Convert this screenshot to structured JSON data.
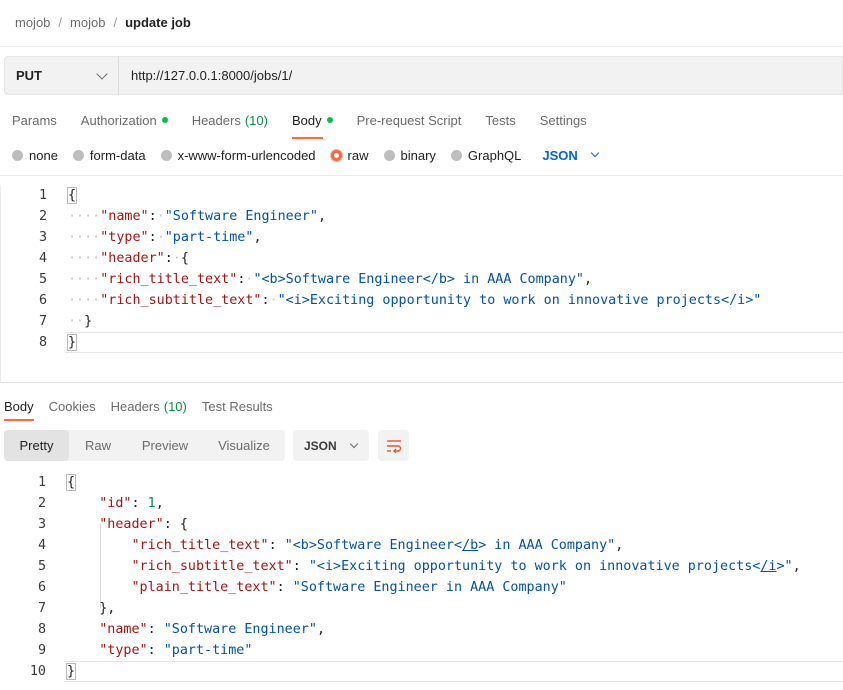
{
  "breadcrumb": {
    "items": [
      "mojob",
      "mojob"
    ],
    "current": "update job",
    "separator": "/"
  },
  "request": {
    "method": "PUT",
    "url": "http://127.0.0.1:8000/jobs/1/"
  },
  "request_tabs": {
    "params": "Params",
    "authorization": "Authorization",
    "headers": "Headers",
    "headers_count": "(10)",
    "body": "Body",
    "prerequest": "Pre-request Script",
    "tests": "Tests",
    "settings": "Settings"
  },
  "body_types": {
    "none": "none",
    "form_data": "form-data",
    "urlencoded": "x-www-form-urlencoded",
    "raw": "raw",
    "binary": "binary",
    "graphql": "GraphQL",
    "format": "JSON",
    "selected": "raw"
  },
  "request_body": {
    "line_numbers": [
      "1",
      "2",
      "3",
      "4",
      "5",
      "6",
      "7",
      "8"
    ],
    "name_key": "\"name\"",
    "name_val": "\"Software Engineer\"",
    "type_key": "\"type\"",
    "type_val": "\"part-time\"",
    "header_key": "\"header\"",
    "rich_title_key": "\"rich_title_text\"",
    "rich_title_val": "\"<b>Software Engineer</b> in AAA Company\"",
    "rich_subtitle_key": "\"rich_subtitle_text\"",
    "rich_subtitle_val": "\"<i>Exciting opportunity to work on innovative projects</i>\""
  },
  "response_tabs": {
    "body": "Body",
    "cookies": "Cookies",
    "headers": "Headers",
    "headers_count": "(10)",
    "test_results": "Test Results"
  },
  "response_view": {
    "pretty": "Pretty",
    "raw": "Raw",
    "preview": "Preview",
    "visualize": "Visualize",
    "format": "JSON",
    "wrap_icon": "wrap-lines-icon"
  },
  "response_body": {
    "line_numbers": [
      "1",
      "2",
      "3",
      "4",
      "5",
      "6",
      "7",
      "8",
      "9",
      "10"
    ],
    "id_key": "\"id\"",
    "id_val": "1",
    "header_key": "\"header\"",
    "rich_title_key": "\"rich_title_text\"",
    "rich_title_pre": "\"<b>Software Engineer<",
    "rich_title_mark": "/b",
    "rich_title_post": "> in AAA Company\"",
    "rich_subtitle_key": "\"rich_subtitle_text\"",
    "rich_subtitle_pre": "\"<i>Exciting opportunity to work on innovative projects<",
    "rich_subtitle_mark": "/i",
    "rich_subtitle_post": ">\"",
    "plain_title_key": "\"plain_title_text\"",
    "plain_title_val": "\"Software Engineer in AAA Company\"",
    "name_key": "\"name\"",
    "name_val": "\"Software Engineer\"",
    "type_key": "\"type\"",
    "type_val": "\"part-time\""
  },
  "colors": {
    "accent": "#ff6c37",
    "status_dot": "#0cbb52",
    "json_key": "#a31515",
    "json_string": "#0451a5",
    "json_number": "#098658",
    "link_blue": "#0265d2"
  }
}
